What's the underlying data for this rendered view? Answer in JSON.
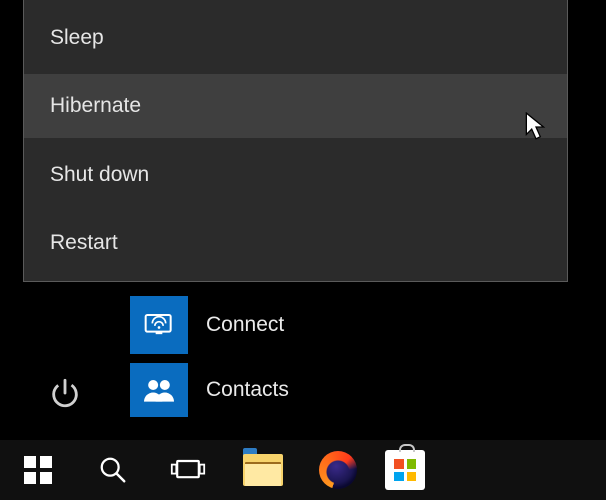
{
  "power_menu": {
    "items": [
      {
        "label": "Sleep"
      },
      {
        "label": "Hibernate"
      },
      {
        "label": "Shut down"
      },
      {
        "label": "Restart"
      }
    ]
  },
  "start_apps": {
    "items": [
      {
        "label": "Connect"
      },
      {
        "label": "Contacts"
      }
    ]
  }
}
